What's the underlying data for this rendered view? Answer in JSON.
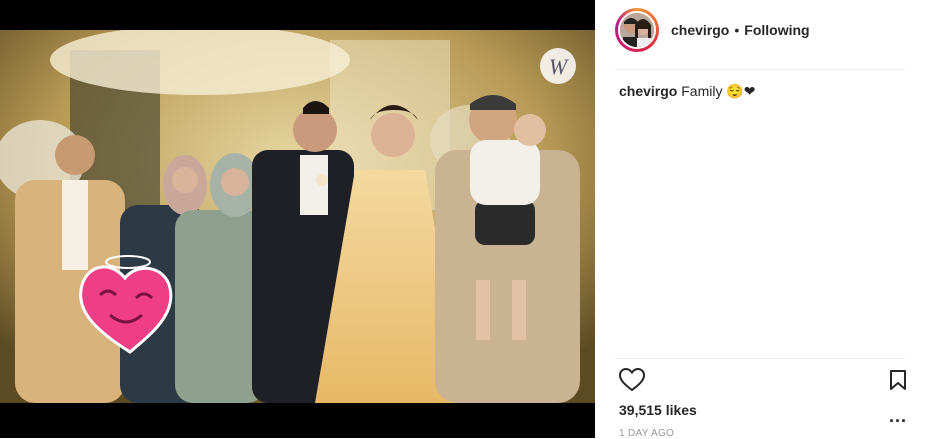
{
  "post": {
    "username": "chevirgo",
    "separator": "•",
    "follow_status": "Following",
    "caption_user": "chevirgo",
    "caption_text": "Family 😌❤",
    "likes": "39,515 likes",
    "time": "1 DAY AGO",
    "more": "..."
  },
  "photo": {
    "description_icon": "wedding-family-photo",
    "watermark_letter": "W",
    "sticker": "heart-face-sticker"
  },
  "icons": {
    "like": "heart-outline-icon",
    "save": "bookmark-icon",
    "more": "more-options-icon"
  }
}
